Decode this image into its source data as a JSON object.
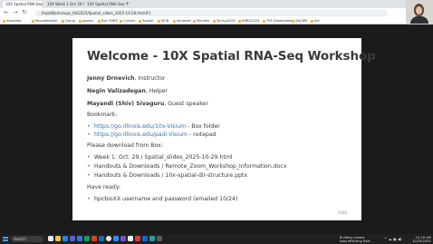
{
  "browser": {
    "tabs": [
      {
        "label": "10X Spatial RNA-Seq Works"
      },
      {
        "label": "10X Week 1 Oct 29 Worksh"
      },
      {
        "label": "10X Spatial RNA-Seq Works"
      }
    ],
    "new_tab_symbol": "+",
    "back_symbol": "←",
    "forward_symbol": "→",
    "reload_symbol": "↻",
    "url": "…/hub/Workshops_fall2025/Spatial_slides_2025-10-29.html#1",
    "bookmarks": [
      "Imported",
      "Recordkeeper",
      "Group",
      "papers",
      "Box CNRG",
      "Current",
      "Spatial",
      "MCB",
      "Keyweek",
      "Minutes",
      "Spring2025",
      "ENRG2024",
      "TSS Datasheets",
      "AACBM",
      "old"
    ]
  },
  "slide": {
    "title": "Welcome - 10X Spatial RNA-Seq Workshop",
    "people": [
      {
        "name": "Jenny Drnevich",
        "role": ", Instructor"
      },
      {
        "name": "Negin Valizadegan",
        "role": ", Helper"
      },
      {
        "name": "Mayandi (Shiv) Sivaguru",
        "role": ", Guest speaker"
      }
    ],
    "bookmark_heading": "Bookmark:",
    "bookmark_items": [
      {
        "link": "https://go.illinois.edu/10x-Visium",
        "suffix": " - Box folder"
      },
      {
        "link": "https://go.illinois.edu/padi-Visium",
        "suffix": " - notepad"
      }
    ],
    "download_heading": "Please download from Box:",
    "download_items": [
      "Week 1: Oct. 29 / Spatial_slides_2025-10-29.html",
      "Handouts & Downloads / Remote_Zoom_Workshop_Information.docx",
      "Handouts & Downloads / 10x-spatial-dir-structure.pptx"
    ],
    "ready_heading": "Have ready:",
    "ready_items": [
      "hpcbioXX username and password (emailed 10/24)"
    ],
    "page_number": "2/64"
  },
  "taskbar": {
    "search_label": "Search",
    "weather_line1": "Building smoke",
    "weather_line2": "Now affecting Rain",
    "tray_symbols": "^ ☁ ▣ ◀)",
    "time": "10:29 AM",
    "date": "10/29/2025"
  },
  "colors": {
    "accent_link": "#2e73b8",
    "slide_text": "#3a3a3a",
    "backdrop": "#1b1b1b",
    "windows_blue": "#3aa3f0"
  }
}
